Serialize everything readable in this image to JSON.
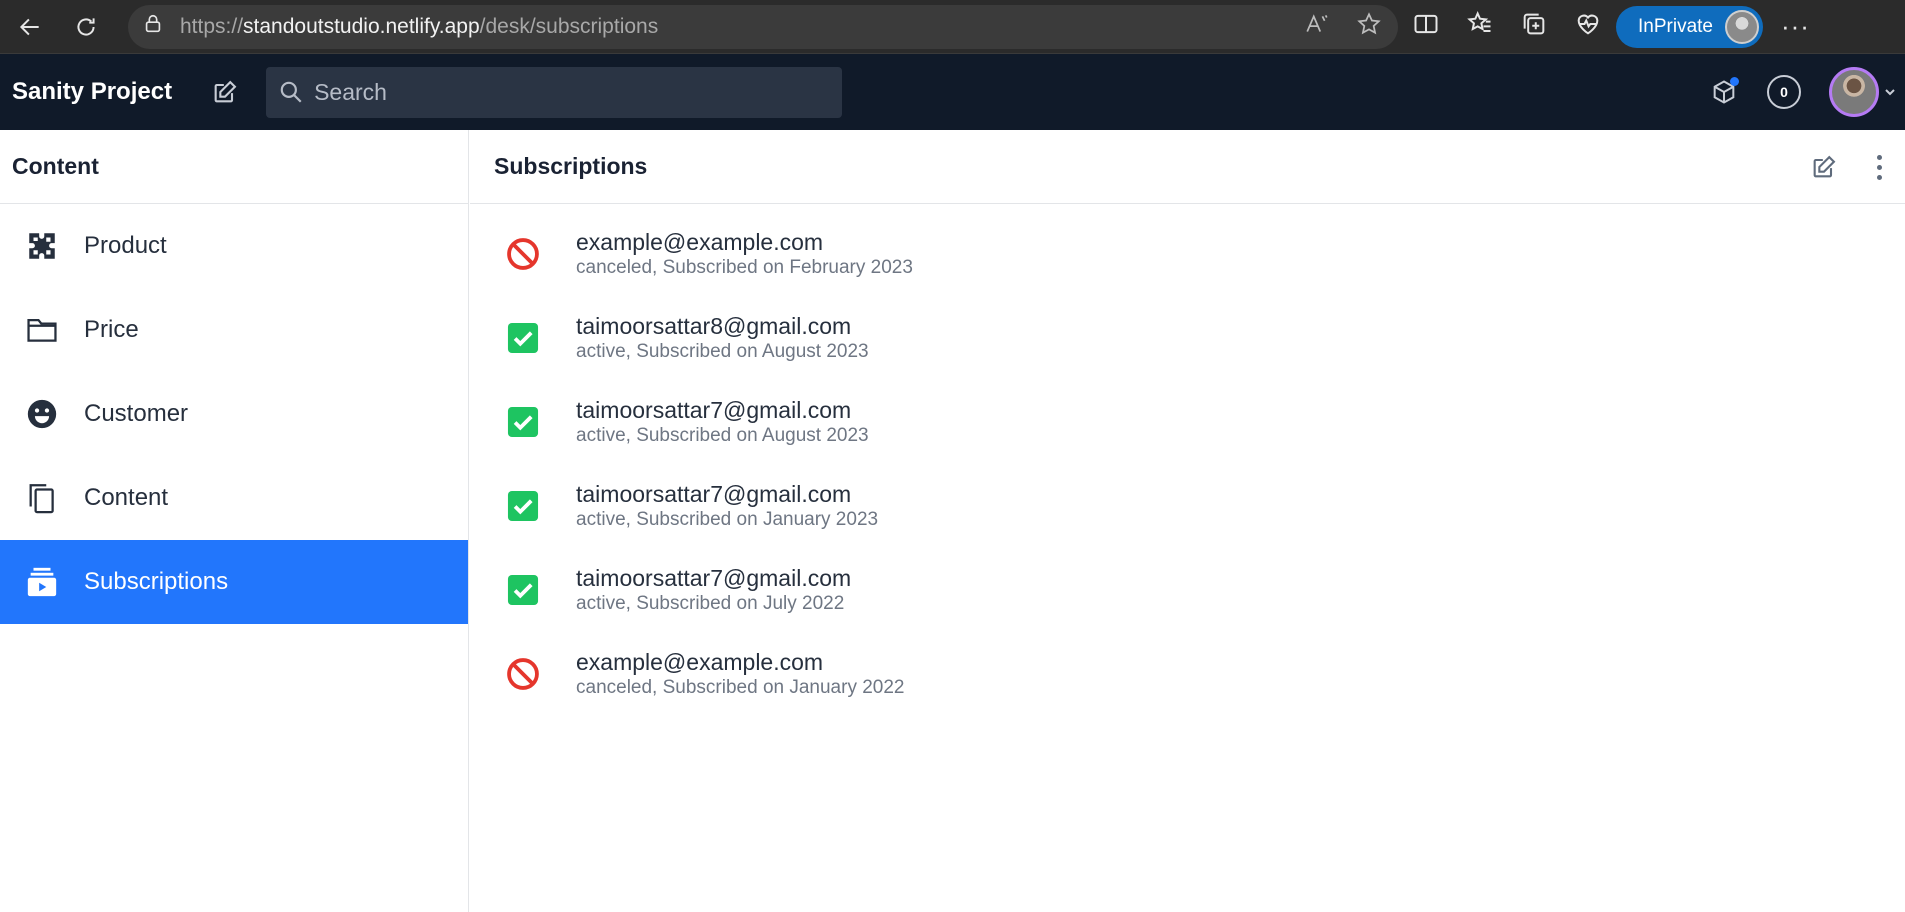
{
  "browser": {
    "url_prefix": "https://",
    "url_host": "standoutstudio.netlify.app",
    "url_path": "/desk/subscriptions",
    "inprivate_label": "InPrivate",
    "more_label": "···"
  },
  "studio": {
    "project_title": "Sanity Project",
    "search_placeholder": "Search",
    "counter": "0"
  },
  "left_pane": {
    "title": "Content",
    "items": [
      {
        "label": "Product",
        "icon": "puzzle-icon"
      },
      {
        "label": "Price",
        "icon": "folder-icon"
      },
      {
        "label": "Customer",
        "icon": "smiley-icon"
      },
      {
        "label": "Content",
        "icon": "copy-icon"
      },
      {
        "label": "Subscriptions",
        "icon": "subscriptions-icon",
        "active": true
      }
    ]
  },
  "right_pane": {
    "title": "Subscriptions",
    "rows": [
      {
        "email": "example@example.com",
        "subtitle": "canceled, Subscribed on February 2023",
        "status": "canceled"
      },
      {
        "email": "taimoorsattar8@gmail.com",
        "subtitle": "active, Subscribed on August 2023",
        "status": "active"
      },
      {
        "email": "taimoorsattar7@gmail.com",
        "subtitle": "active, Subscribed on August 2023",
        "status": "active"
      },
      {
        "email": "taimoorsattar7@gmail.com",
        "subtitle": "active, Subscribed on January 2023",
        "status": "active"
      },
      {
        "email": "taimoorsattar7@gmail.com",
        "subtitle": "active, Subscribed on July 2022",
        "status": "active"
      },
      {
        "email": "example@example.com",
        "subtitle": "canceled, Subscribed on January 2022",
        "status": "canceled"
      }
    ]
  },
  "colors": {
    "accent": "#2276fc",
    "active_status": "#1ec461",
    "canceled_status": "#e5362c",
    "navbar": "#101a29"
  }
}
